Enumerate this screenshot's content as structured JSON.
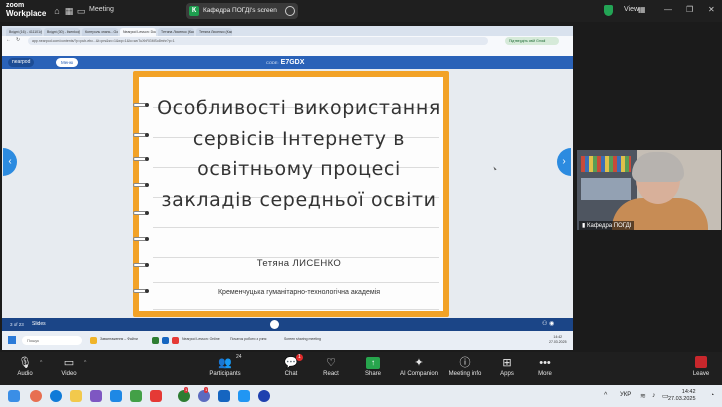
{
  "zoom_topbar": {
    "logo_line1": "zoom",
    "logo_line2": "Workplace",
    "meeting_label": "Meeting",
    "screen_share_initial": "К",
    "screen_share_title": "Кафедра ПОГДІ's screen",
    "view_label": "View"
  },
  "browser": {
    "tabs": [
      "Вхідні (16) - 411101@gmail.co",
      "Вхідні (30) - lisenko@ya.org",
      "Контроль знань - Google Диск",
      "Nearpod Lesson: Download",
      "Tетяна Лисенко (Кафедра ПОГДІ)",
      "Тетяна Лисенко (Кафедра ПОГДІ)"
    ],
    "address": "app.nearpod.com/contents/?p=pub-ebc...&t=prs&sv=1&wp=1&lo=wcTuXhRGMSo8mhr?p=1",
    "gmail_chip": "Підтвердіть свій Gmail"
  },
  "nearpod": {
    "logo": "nearpod",
    "menu_label": "Меню",
    "code_label": "CODE:",
    "code": "E7GDX",
    "page_count": "3 of 23",
    "slides_label": "Slides"
  },
  "slide": {
    "title_lines": [
      "Особливості використання",
      "сервісів Інтернету в",
      "освітньому процесі",
      "закладів середньої освіти"
    ],
    "author": "Тетяна ЛИСЕНКО",
    "organization": "Кременчуцька гуманітарно-технологічна академія"
  },
  "inner_taskbar": {
    "search_placeholder": "Пошук",
    "items": [
      "Завантаження – Файли",
      "Nearpod Lesson: Online",
      "Початок роботи з учня",
      "Screen sharing meeting"
    ],
    "clock_time": "14:42",
    "clock_date": "27.03.2025"
  },
  "participant": {
    "label": "Кафедра ПОГДІ"
  },
  "zoom_toolbar": {
    "audio": "Audio",
    "video": "Video",
    "participants": "Participants",
    "participants_count": "24",
    "chat": "Chat",
    "chat_badge": "1",
    "react": "React",
    "share": "Share",
    "ai_companion": "AI Companion",
    "meeting_info": "Meeting info",
    "apps": "Apps",
    "more": "More",
    "leave": "Leave"
  },
  "windows_taskbar": {
    "language": "УКР",
    "time": "14:42",
    "date": "27.03.2025",
    "badge_1": "1",
    "badge_2": "1"
  }
}
